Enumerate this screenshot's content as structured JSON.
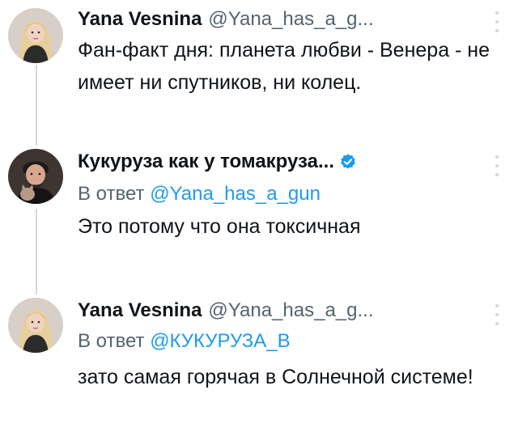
{
  "colors": {
    "accent": "#1d9bf0",
    "secondary_text": "#536471",
    "thread_line": "#cfd9de"
  },
  "tweets": [
    {
      "avatar": "blonde-woman-avatar",
      "name": "Yana Vesnina",
      "handle": "@Yana_has_a_g...",
      "verified": false,
      "reply_prefix": "",
      "reply_to": "",
      "text": "Фан-факт дня: планета любви - Венера - не имеет ни спутников, ни колец."
    },
    {
      "avatar": "man-with-cat-avatar",
      "name": "Кукуруза как у томакруза...",
      "handle": "",
      "verified": true,
      "reply_prefix": "В ответ",
      "reply_to": "@Yana_has_a_gun",
      "text": "Это потому что она токсичная"
    },
    {
      "avatar": "blonde-woman-avatar",
      "name": "Yana Vesnina",
      "handle": "@Yana_has_a_g...",
      "verified": false,
      "reply_prefix": "В ответ",
      "reply_to": "@КУКУРУЗА_В",
      "text": "зато самая горячая в Солнечной системе!"
    }
  ]
}
